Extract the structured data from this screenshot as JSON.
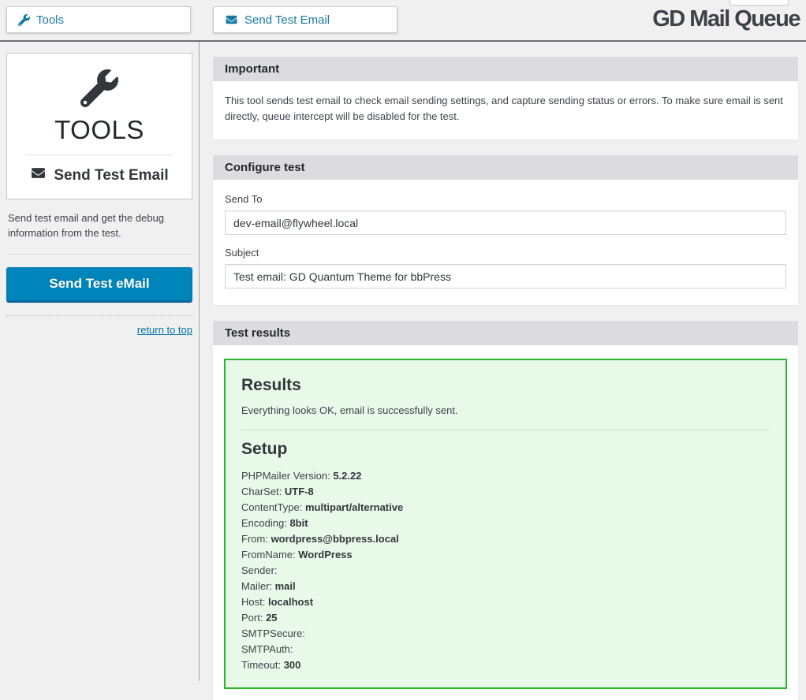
{
  "page": {
    "title": "GD Mail Queue"
  },
  "tabs": [
    {
      "label": "Tools",
      "icon": "wrench-icon"
    },
    {
      "label": "Send Test Email",
      "icon": "envelope-icon"
    }
  ],
  "sidebar": {
    "panel_title": "TOOLS",
    "panel_subtitle": "Send Test Email",
    "description": "Send test email and get the debug information from the test.",
    "send_button_label": "Send Test eMail",
    "return_link": "return to top"
  },
  "sections": {
    "important": {
      "title": "Important",
      "body": "This tool sends test email to check email sending settings, and capture sending status or errors. To make sure email is sent directly, queue intercept will be disabled for the test."
    },
    "configure": {
      "title": "Configure test",
      "send_to_label": "Send To",
      "send_to_value": "dev-email@flywheel.local",
      "subject_label": "Subject",
      "subject_value": "Test email: GD Quantum Theme for bbPress"
    },
    "results": {
      "title": "Test results",
      "results_heading": "Results",
      "results_message": "Everything looks OK, email is successfully sent.",
      "setup_heading": "Setup",
      "setup_items": [
        {
          "label": "PHPMailer Version",
          "value": "5.2.22"
        },
        {
          "label": "CharSet",
          "value": "UTF-8"
        },
        {
          "label": "ContentType",
          "value": "multipart/alternative"
        },
        {
          "label": "Encoding",
          "value": "8bit"
        },
        {
          "label": "From",
          "value": "wordpress@bbpress.local"
        },
        {
          "label": "FromName",
          "value": "WordPress"
        },
        {
          "label": "Sender",
          "value": ""
        },
        {
          "label": "Mailer",
          "value": "mail"
        },
        {
          "label": "Host",
          "value": "localhost"
        },
        {
          "label": "Port",
          "value": "25"
        },
        {
          "label": "SMTPSecure",
          "value": ""
        },
        {
          "label": "SMTPAuth",
          "value": ""
        },
        {
          "label": "Timeout",
          "value": "300"
        }
      ]
    }
  },
  "colors": {
    "accent_blue": "#0073aa",
    "button_blue": "#0085ba",
    "success_green_border": "#2db52d",
    "success_green_bg": "#e9f9e9",
    "header_bar_gray": "#dcdcde",
    "page_bg": "#f0f0f1",
    "dark_text": "#32373c"
  }
}
